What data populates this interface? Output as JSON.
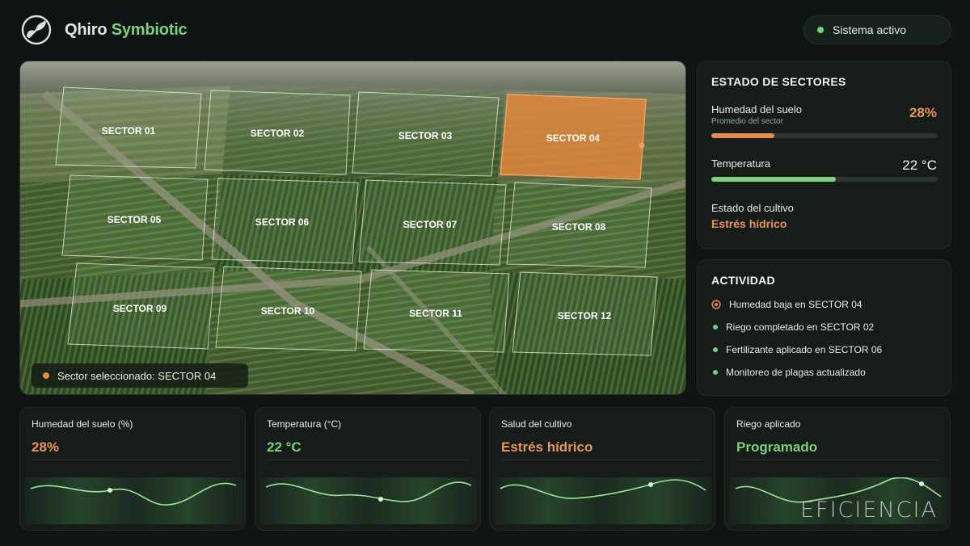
{
  "header": {
    "brand_part1": "Qhiro",
    "brand_part2": "Symbiotic",
    "status": "Sistema activo"
  },
  "map": {
    "sectors": [
      {
        "label": "SECTOR 01",
        "selected": false
      },
      {
        "label": "SECTOR 02",
        "selected": false
      },
      {
        "label": "SECTOR 03",
        "selected": false
      },
      {
        "label": "SECTOR 04",
        "selected": true
      },
      {
        "label": "SECTOR 05",
        "selected": false
      },
      {
        "label": "SECTOR 06",
        "selected": false
      },
      {
        "label": "SECTOR 07",
        "selected": false
      },
      {
        "label": "SECTOR 08",
        "selected": false
      },
      {
        "label": "SECTOR 09",
        "selected": false
      },
      {
        "label": "SECTOR 10",
        "selected": false
      },
      {
        "label": "SECTOR 11",
        "selected": false
      },
      {
        "label": "SECTOR 12",
        "selected": false
      }
    ],
    "caption": "Sector seleccionado: SECTOR 04"
  },
  "sector_status": {
    "title": "ESTADO DE SECTORES",
    "humidity_label": "Humedad del suelo",
    "humidity_sub": "Promedio del sector",
    "humidity_value": "28%",
    "humidity_fraction": 0.28,
    "temperature_label": "Temperatura",
    "temperature_value": "22 °C",
    "temperature_fraction": 0.55,
    "crop_label": "Estado del cultivo",
    "crop_value": "Estrés hídrico"
  },
  "activity": {
    "title": "ACTIVIDAD",
    "items": [
      {
        "text": "Humedad baja en SECTOR 04",
        "icon": "alert-icon"
      },
      {
        "text": "Riego completado en SECTOR 02",
        "icon": "dot"
      },
      {
        "text": "Fertilizante aplicado en SECTOR 06",
        "icon": "dot"
      },
      {
        "text": "Monitoreo de plagas actualizado",
        "icon": "dot"
      }
    ]
  },
  "kpis": [
    {
      "title": "Humedad del suelo (%)",
      "value": "28%",
      "color": "#e8955a"
    },
    {
      "title": "Temperatura (°C)",
      "value": "22 °C",
      "color": "#7ed07e"
    },
    {
      "title": "Salud del cultivo",
      "value": "Estrés hídrico",
      "color": "#e8955a"
    },
    {
      "title": "Riego aplicado",
      "value": "Programado",
      "color": "#7ed07e"
    }
  ],
  "watermark": "EFICIENCIA",
  "colors": {
    "accent_green": "#7ed07e",
    "accent_orange": "#e8894a",
    "panel": "#161d19"
  }
}
